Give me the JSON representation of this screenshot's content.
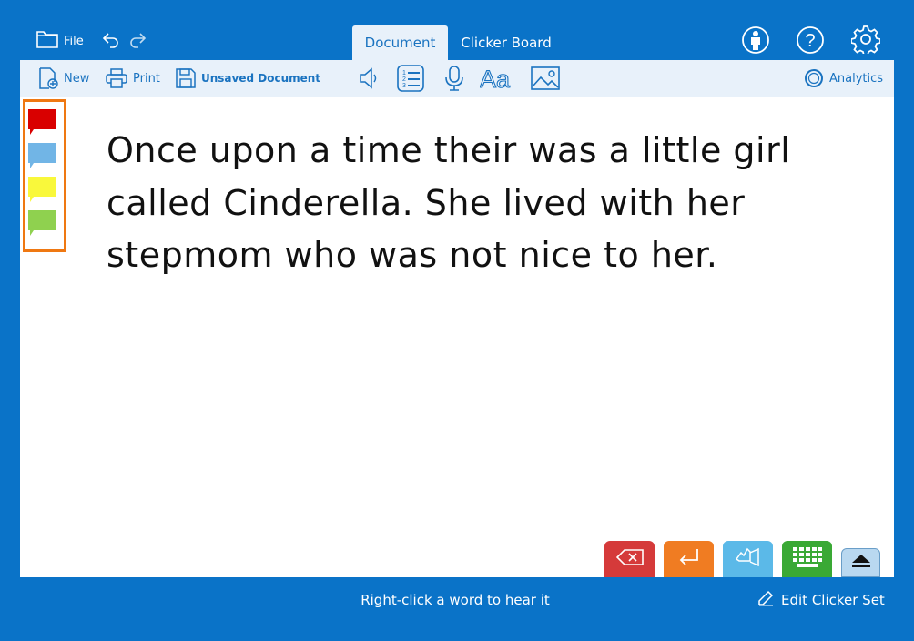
{
  "header": {
    "file_label": "File",
    "tabs": [
      {
        "label": "Document",
        "active": true
      },
      {
        "label": "Clicker Board",
        "active": false
      }
    ],
    "icons": [
      "folder-icon",
      "undo-icon",
      "redo-icon",
      "person-icon",
      "help-icon",
      "settings-gear-icon"
    ]
  },
  "toolbar": {
    "new_label": "New",
    "print_label": "Print",
    "document_name": "Unsaved Document",
    "analytics_label": "Analytics",
    "icons": [
      "speaker-icon",
      "numbered-list-icon",
      "microphone-icon",
      "font-aa-icon",
      "image-icon"
    ]
  },
  "document": {
    "lines": [
      "Once upon a time their was a little girl",
      "called Cinderella. She lived with her",
      "stepmom who was not nice to her."
    ]
  },
  "speech_bubbles": {
    "colors": [
      "#d90000",
      "#71b5e6",
      "#f9f83b",
      "#8fd14f"
    ],
    "panel_border_color": "#ef7812"
  },
  "bottom_buttons": [
    {
      "name": "backspace-button",
      "icon": "backspace-icon",
      "color": "#d53a3a"
    },
    {
      "name": "enter-button",
      "icon": "enter-icon",
      "color": "#f07c22"
    },
    {
      "name": "speak-button",
      "icon": "speaker-hand-icon",
      "color": "#5bb9e8"
    },
    {
      "name": "keyboard-button",
      "icon": "keyboard-icon",
      "color": "#3aa935"
    },
    {
      "name": "collapse-button",
      "icon": "eject-up-icon",
      "color": "#b9d8f0"
    }
  ],
  "status": {
    "hint": "Right-click a word to hear it",
    "edit_label": "Edit Clicker Set"
  },
  "colors": {
    "brand_blue": "#0a73c8",
    "toolbar_bg": "#e8f1fa",
    "accent_text": "#1a73c0"
  }
}
